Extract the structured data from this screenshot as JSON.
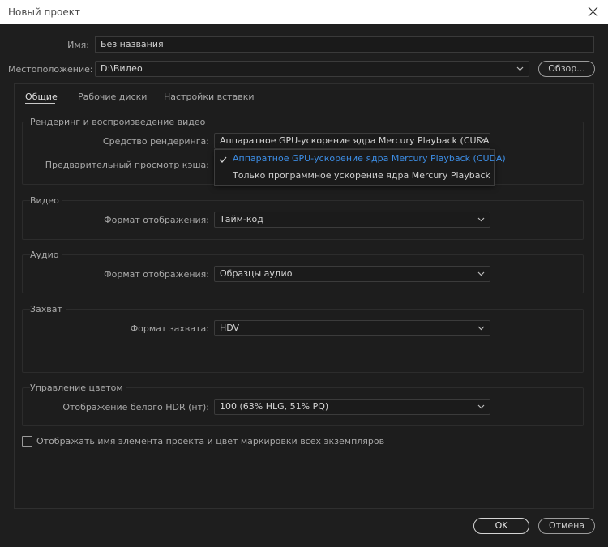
{
  "window": {
    "title": "Новый проект"
  },
  "name_label": "Имя:",
  "name_value": "Без названия",
  "location_label": "Местоположение:",
  "location_value": "D:\\Видео",
  "browse_label": "Обзор...",
  "tabs": [
    {
      "label": "Общие",
      "active": true
    },
    {
      "label": "Рабочие диски",
      "active": false
    },
    {
      "label": "Настройки вставки",
      "active": false
    }
  ],
  "render_group": {
    "title": "Рендеринг и воспроизведение видео",
    "renderer_label": "Средство рендеринга:",
    "renderer_value": "Аппаратное GPU-ускорение ядра Mercury Playback (CUDA)",
    "cache_label": "Предварительный просмотр кэша:"
  },
  "renderer_options": [
    {
      "label": "Аппаратное GPU-ускорение ядра Mercury Playback (CUDA)",
      "selected": true
    },
    {
      "label": "Только программное ускорение ядра Mercury Playback",
      "selected": false
    }
  ],
  "video_group": {
    "title": "Видео",
    "format_label": "Формат отображения:",
    "format_value": "Тайм-код"
  },
  "audio_group": {
    "title": "Аудио",
    "format_label": "Формат отображения:",
    "format_value": "Образцы аудио"
  },
  "capture_group": {
    "title": "Захват",
    "format_label": "Формат захвата:",
    "format_value": "HDV"
  },
  "color_group": {
    "title": "Управление цветом",
    "hdr_label": "Отображение белого HDR (нт):",
    "hdr_value": "100 (63% HLG, 51% PQ)"
  },
  "checkbox": {
    "label": "Отображать имя элемента проекта и цвет маркировки всех экземпляров",
    "checked": false
  },
  "ok_label": "OK",
  "cancel_label": "Отмена",
  "colors": {
    "background": "#1e1e1e",
    "accent": "#3d8ee6",
    "titlebar": "#ffffff"
  },
  "icons": {
    "close": "close-icon",
    "chevron": "chevron-down-icon",
    "check": "check-icon"
  }
}
